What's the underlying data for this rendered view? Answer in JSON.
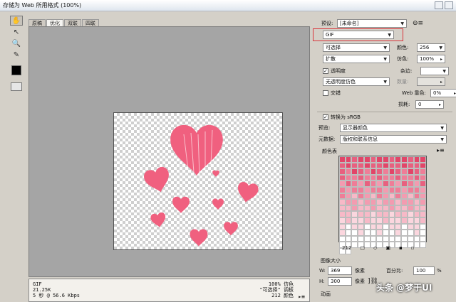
{
  "window": {
    "title": "存储为 Web 所用格式 (100%)"
  },
  "tabs": [
    "原稿",
    "优化",
    "双联",
    "四联"
  ],
  "active_tab": 1,
  "status": {
    "left_lines": [
      "GIF",
      "21.25K",
      "5 秒 @ 56.6 Kbps"
    ],
    "right_lines": [
      "100% 仿色",
      "\"可选择\" 调板",
      "212 颜色"
    ],
    "menu_icon": "menu-icon"
  },
  "panel": {
    "preset_label": "预设:",
    "preset_value": "[未命名]",
    "format_value": "GIF",
    "reduction_value": "可选择",
    "colors_label": "颜色:",
    "colors_value": "256",
    "dither_algo_value": "扩散",
    "dither_label": "仿色:",
    "dither_value": "100%",
    "transparency_label": "透明度",
    "matte_label": "杂边:",
    "trans_dither_value": "无透明度仿色",
    "amount_label": "数量:",
    "interlaced_label": "交错",
    "web_snap_label": "Web 靠色:",
    "web_snap_value": "0%",
    "lossy_label": "损耗:",
    "lossy_value": "0",
    "convert_srgb_label": "转换为 sRGB",
    "preview_label": "预览:",
    "preview_value": "显示器颜色",
    "metadata_label": "元数据:",
    "metadata_value": "版权和联系信息",
    "color_table_label": "颜色表",
    "color_count": "212",
    "image_size_label": "图像大小",
    "w_label": "W:",
    "w_value": "369",
    "h_label": "H:",
    "h_value": "300",
    "px_unit": "像素",
    "percent_label": "百分比:",
    "percent_value": "100",
    "percent_unit": "%",
    "animation_label": "动画"
  },
  "colors": {
    "heart": "#f0607f",
    "palette": [
      "#e24568",
      "#e8607f",
      "#ef7d97",
      "#f39bb0",
      "#f7b9c7",
      "#fbd6de",
      "#ffffff"
    ]
  },
  "watermark": "头条 @梦于UI"
}
